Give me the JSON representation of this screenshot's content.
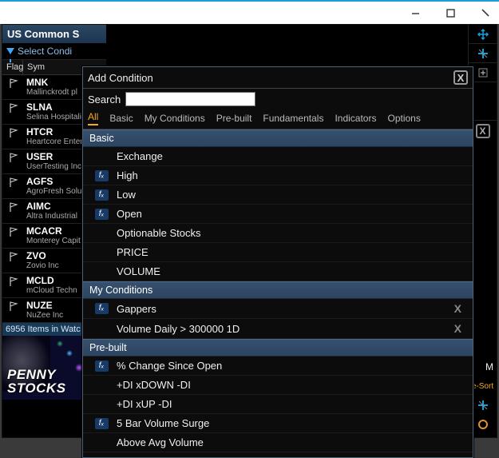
{
  "window": {
    "minimize": "—",
    "maximize": "☐",
    "close": "✕"
  },
  "watcher": {
    "title": "US Common S",
    "filter_label": "Select Condi",
    "columns": {
      "flag": "Flag",
      "sym": "Sym"
    },
    "rows": [
      {
        "ticker": "MNK",
        "name": "Mallinckrodt pl"
      },
      {
        "ticker": "SLNA",
        "name": "Selina Hospitali"
      },
      {
        "ticker": "HTCR",
        "name": "Heartcore Enter"
      },
      {
        "ticker": "USER",
        "name": "UserTesting Inc"
      },
      {
        "ticker": "AGFS",
        "name": "AgroFresh Solu"
      },
      {
        "ticker": "AIMC",
        "name": "Altra Industrial"
      },
      {
        "ticker": "MCACR",
        "name": "Monterey Capit"
      },
      {
        "ticker": "ZVO",
        "name": "Zovio Inc"
      },
      {
        "ticker": "MCLD",
        "name": "mCloud Techn"
      },
      {
        "ticker": "NUZE",
        "name": "NuZee  Inc"
      }
    ],
    "status": "6956 Items in Watc",
    "banner_line1": "PENNY",
    "banner_line2": "STOCKS"
  },
  "sort_toggle": "e-Sort",
  "modal": {
    "title": "Add Condition",
    "close": "X",
    "search_label": "Search",
    "search_value": "",
    "search_placeholder": "",
    "tabs": [
      "All",
      "Basic",
      "My Conditions",
      "Pre-built",
      "Fundamentals",
      "Indicators",
      "Options"
    ],
    "active_tab": 0,
    "sections": [
      {
        "header": "Basic",
        "items": [
          {
            "fx": false,
            "label": "Exchange"
          },
          {
            "fx": true,
            "label": "High"
          },
          {
            "fx": true,
            "label": "Low"
          },
          {
            "fx": true,
            "label": "Open"
          },
          {
            "fx": false,
            "label": "Optionable Stocks"
          },
          {
            "fx": false,
            "label": "PRICE"
          },
          {
            "fx": false,
            "label": "VOLUME"
          }
        ]
      },
      {
        "header": "My Conditions",
        "items": [
          {
            "fx": true,
            "label": "Gappers",
            "removable": true
          },
          {
            "fx": false,
            "label": "Volume  Daily > 300000 1D",
            "removable": true
          }
        ]
      },
      {
        "header": "Pre-built",
        "items": [
          {
            "fx": true,
            "label": "% Change Since Open"
          },
          {
            "fx": false,
            "label": "+DI xDOWN -DI"
          },
          {
            "fx": false,
            "label": "+DI xUP -DI"
          },
          {
            "fx": true,
            "label": "5 Bar Volume Surge"
          },
          {
            "fx": false,
            "label": "Above Avg Volume"
          }
        ]
      }
    ]
  }
}
